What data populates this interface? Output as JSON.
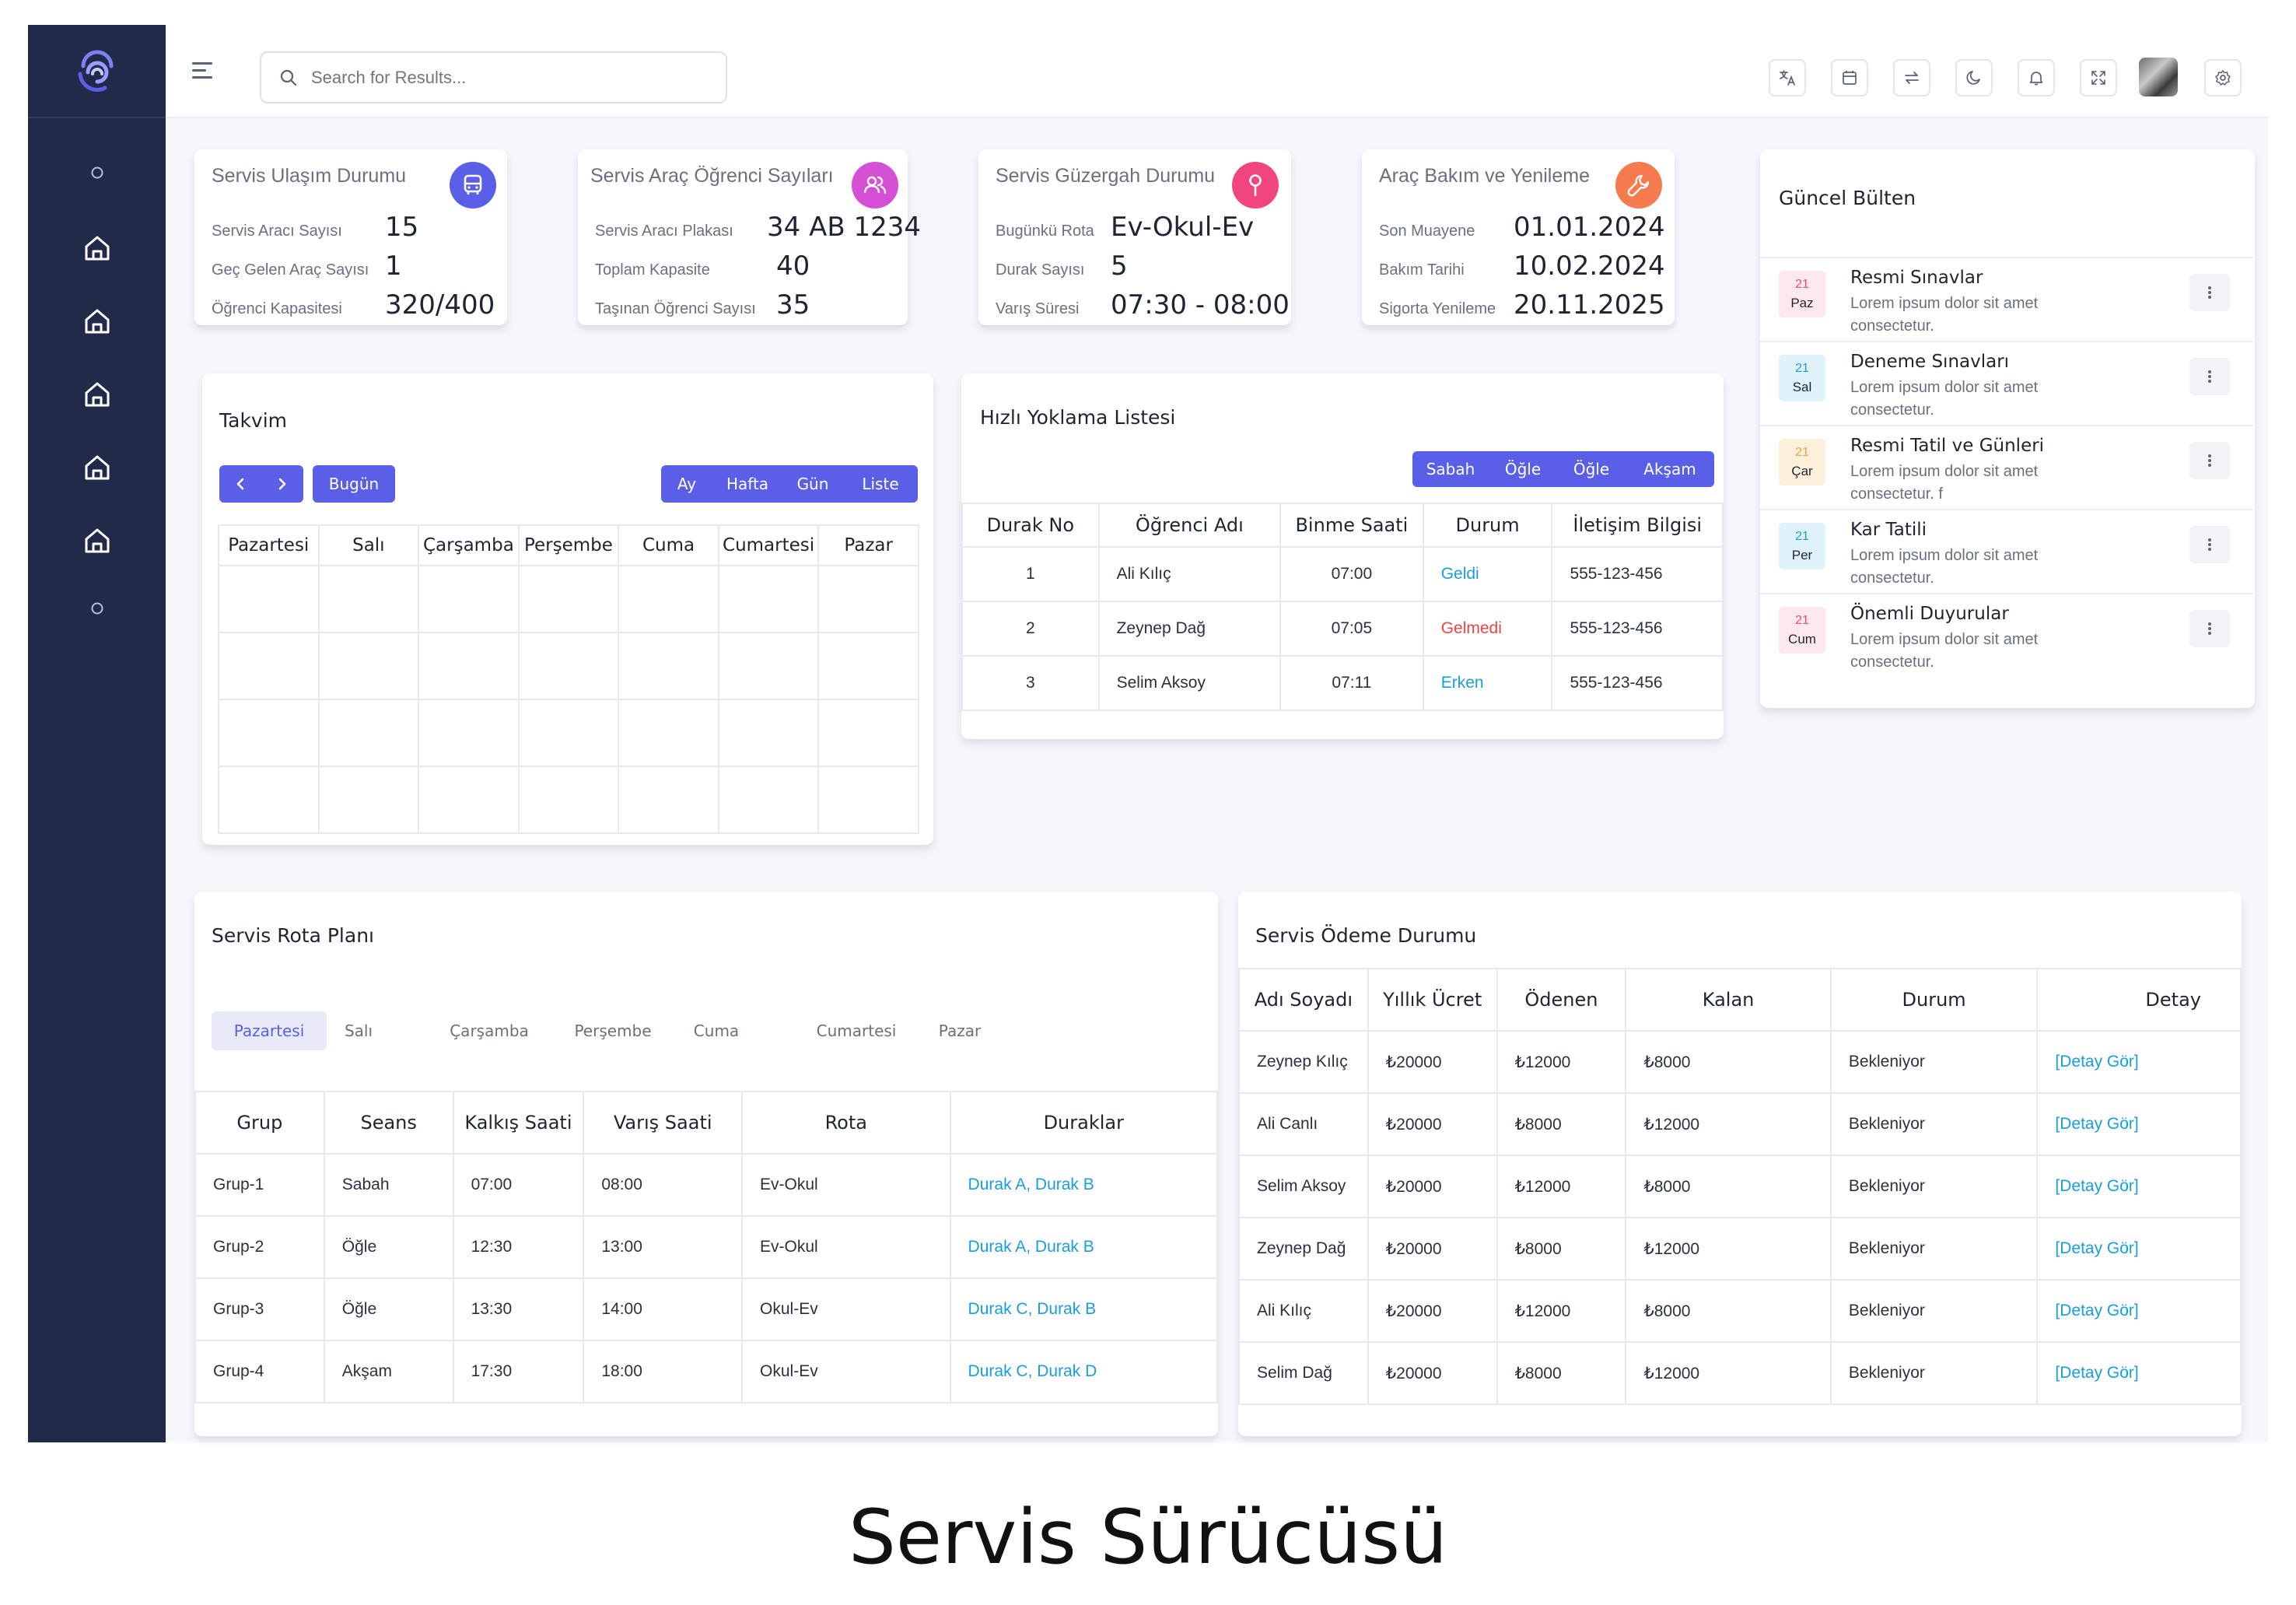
{
  "header": {
    "search_placeholder": "Search for Results..."
  },
  "stats": [
    {
      "title": "Servis Ulaşım Durumu",
      "icon": "bus-icon",
      "color": "#5a5fe8",
      "rows": [
        {
          "label": "Servis Aracı Sayısı",
          "value": "15"
        },
        {
          "label": "Geç Gelen Araç Sayısı",
          "value": "1"
        },
        {
          "label": "Öğrenci Kapasitesi",
          "value": "320/400"
        }
      ]
    },
    {
      "title": "Servis Araç Öğrenci Sayıları",
      "icon": "users-icon",
      "color": "#d44fd4",
      "rows": [
        {
          "label": "Servis Aracı Plakası",
          "value": "34 AB 1234"
        },
        {
          "label": "Toplam Kapasite",
          "value": "40"
        },
        {
          "label": "Taşınan Öğrenci Sayısı",
          "value": "35"
        }
      ]
    },
    {
      "title": "Servis Güzergah Durumu",
      "icon": "map-pin-icon",
      "color": "#f0457f",
      "rows": [
        {
          "label": "Bugünkü Rota",
          "value": "Ev-Okul-Ev"
        },
        {
          "label": "Durak Sayısı",
          "value": "5"
        },
        {
          "label": "Varış Süresi",
          "value": "07:30 - 08:00"
        }
      ]
    },
    {
      "title": "Araç Bakım ve Yenileme",
      "icon": "wrench-icon",
      "color": "#f47c4c",
      "rows": [
        {
          "label": "Son Muayene",
          "value": "01.01.2024"
        },
        {
          "label": "Bakım Tarihi",
          "value": "10.02.2024"
        },
        {
          "label": "Sigorta Yenileme",
          "value": "20.11.2025"
        }
      ]
    }
  ],
  "calendar": {
    "title": "Takvim",
    "today_label": "Bugün",
    "views": [
      "Ay",
      "Hafta",
      "Gün",
      "Liste"
    ],
    "days": [
      "Pazartesi",
      "Salı",
      "Çarşamba",
      "Perşembe",
      "Cuma",
      "Cumartesi",
      "Pazar"
    ]
  },
  "attendance": {
    "title": "Hızlı Yoklama Listesi",
    "filters": [
      "Sabah",
      "Öğle",
      "Öğle",
      "Akşam"
    ],
    "columns": [
      "Durak No",
      "Öğrenci Adı",
      "Binme Saati",
      "Durum",
      "İletişim Bilgisi"
    ],
    "rows": [
      {
        "no": "1",
        "name": "Ali Kılıç",
        "time": "07:00",
        "status": "Geldi",
        "phone": "555-123-456"
      },
      {
        "no": "2",
        "name": "Zeynep Dağ",
        "time": "07:05",
        "status": "Gelmedi",
        "phone": "555-123-456"
      },
      {
        "no": "3",
        "name": "Selim Aksoy",
        "time": "07:11",
        "status": "Erken",
        "phone": "555-123-456"
      }
    ]
  },
  "bulletin": {
    "title": "Güncel Bülten",
    "items": [
      {
        "day": "21",
        "weekday": "Paz",
        "title": "Resmi Sınavlar",
        "desc": "Lorem ipsum dolor sit amet consectetur.",
        "bg": "#fde8ee",
        "accent": "#e84b75"
      },
      {
        "day": "21",
        "weekday": "Sal",
        "title": "Deneme Sınavları",
        "desc": "Lorem ipsum dolor sit amet consectetur.",
        "bg": "#e0f3fa",
        "accent": "#1a9ed8"
      },
      {
        "day": "21",
        "weekday": "Çar",
        "title": "Resmi Tatil ve Günleri",
        "desc": "Lorem ipsum dolor sit amet consectetur. f",
        "bg": "#fdf1dd",
        "accent": "#f0a13a"
      },
      {
        "day": "21",
        "weekday": "Per",
        "title": "Kar Tatili",
        "desc": "Lorem ipsum dolor sit amet consectetur.",
        "bg": "#e0f3fa",
        "accent": "#1a9ed8"
      },
      {
        "day": "21",
        "weekday": "Cum",
        "title": "Önemli Duyurular",
        "desc": "Lorem ipsum dolor sit amet consectetur.",
        "bg": "#fde8ee",
        "accent": "#e84b75"
      }
    ]
  },
  "route": {
    "title": "Servis Rota Planı",
    "tabs": [
      "Pazartesi",
      "Salı",
      "Çarşamba",
      "Perşembe",
      "Cuma",
      "Cumartesi",
      "Pazar"
    ],
    "columns": [
      "Grup",
      "Seans",
      "Kalkış Saati",
      "Varış Saati",
      "Rota",
      "Duraklar"
    ],
    "rows": [
      {
        "group": "Grup-1",
        "session": "Sabah",
        "dep": "07:00",
        "arr": "08:00",
        "route": "Ev-Okul",
        "stops": "Durak A, Durak B"
      },
      {
        "group": "Grup-2",
        "session": "Öğle",
        "dep": "12:30",
        "arr": "13:00",
        "route": "Ev-Okul",
        "stops": "Durak A, Durak B"
      },
      {
        "group": "Grup-3",
        "session": "Öğle",
        "dep": "13:30",
        "arr": "14:00",
        "route": "Okul-Ev",
        "stops": "Durak C, Durak B"
      },
      {
        "group": "Grup-4",
        "session": "Akşam",
        "dep": "17:30",
        "arr": "18:00",
        "route": "Okul-Ev",
        "stops": "Durak C, Durak D"
      }
    ]
  },
  "payment": {
    "title": "Servis Ödeme Durumu",
    "columns": [
      "Adı Soyadı",
      "Yıllık Ücret",
      "Ödenen",
      "Kalan",
      "Durum",
      "Detay"
    ],
    "rows": [
      {
        "name": "Zeynep Kılıç",
        "fee": "₺20000",
        "paid": "₺12000",
        "left": "₺8000",
        "status": "Bekleniyor",
        "detail": "[Detay Gör]"
      },
      {
        "name": "Ali Canlı",
        "fee": "₺20000",
        "paid": "₺8000",
        "left": "₺12000",
        "status": "Bekleniyor",
        "detail": "[Detay Gör]"
      },
      {
        "name": "Selim Aksoy",
        "fee": "₺20000",
        "paid": "₺12000",
        "left": "₺8000",
        "status": "Bekleniyor",
        "detail": "[Detay Gör]"
      },
      {
        "name": "Zeynep Dağ",
        "fee": "₺20000",
        "paid": "₺8000",
        "left": "₺12000",
        "status": "Bekleniyor",
        "detail": "[Detay Gör]"
      },
      {
        "name": "Ali Kılıç",
        "fee": "₺20000",
        "paid": "₺12000",
        "left": "₺8000",
        "status": "Bekleniyor",
        "detail": "[Detay Gör]"
      },
      {
        "name": "Selim Dağ",
        "fee": "₺20000",
        "paid": "₺8000",
        "left": "₺12000",
        "status": "Bekleniyor",
        "detail": "[Detay Gör]"
      }
    ]
  },
  "caption": "Servis Sürücüsü"
}
